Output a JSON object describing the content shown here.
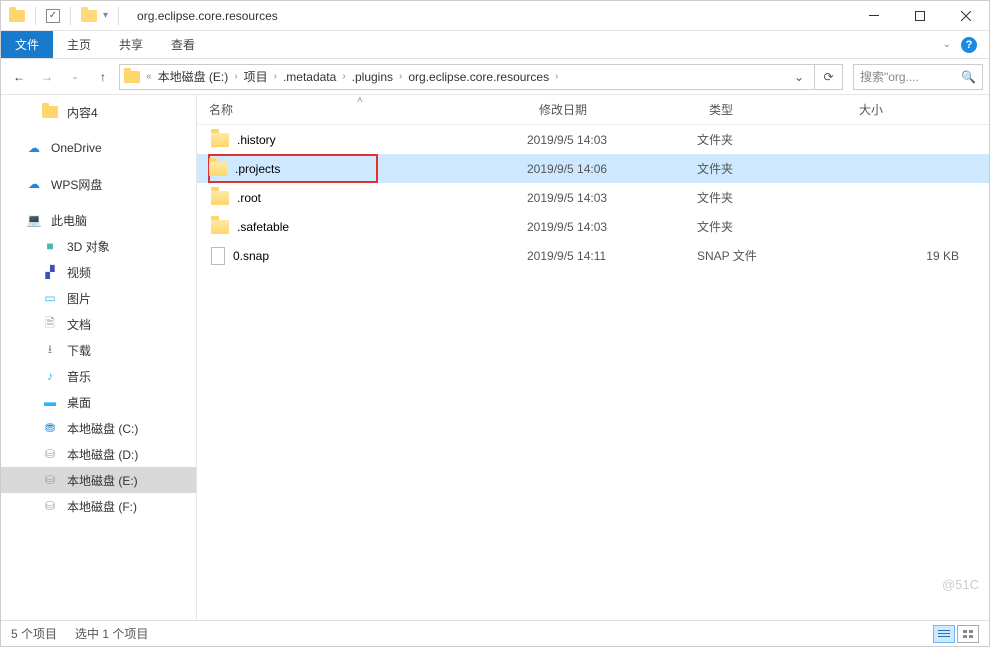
{
  "titlebar": {
    "title": "org.eclipse.core.resources"
  },
  "ribbon": {
    "tabs": [
      "文件",
      "主页",
      "共享",
      "查看"
    ],
    "active_index": 0
  },
  "breadcrumb": {
    "items": [
      "本地磁盘 (E:)",
      "项目",
      ".metadata",
      ".plugins",
      "org.eclipse.core.resources"
    ]
  },
  "search": {
    "placeholder": "搜索\"org...."
  },
  "columns": {
    "name": "名称",
    "date": "修改日期",
    "type": "类型",
    "size": "大小"
  },
  "sidebar": {
    "items": [
      {
        "label": "内容4",
        "icon": "folder",
        "indent": true
      },
      {
        "label": "OneDrive",
        "icon": "cloud"
      },
      {
        "label": "WPS网盘",
        "icon": "cloud-outline"
      },
      {
        "label": "此电脑",
        "icon": "pc"
      },
      {
        "label": "3D 对象",
        "icon": "3d",
        "indent": true
      },
      {
        "label": "视频",
        "icon": "video",
        "indent": true
      },
      {
        "label": "图片",
        "icon": "pic",
        "indent": true
      },
      {
        "label": "文档",
        "icon": "doc",
        "indent": true
      },
      {
        "label": "下载",
        "icon": "download",
        "indent": true
      },
      {
        "label": "音乐",
        "icon": "music",
        "indent": true
      },
      {
        "label": "桌面",
        "icon": "desktop",
        "indent": true
      },
      {
        "label": "本地磁盘 (C:)",
        "icon": "drive-c",
        "indent": true
      },
      {
        "label": "本地磁盘 (D:)",
        "icon": "drive",
        "indent": true
      },
      {
        "label": "本地磁盘 (E:)",
        "icon": "drive",
        "indent": true,
        "selected": true
      },
      {
        "label": "本地磁盘 (F:)",
        "icon": "drive",
        "indent": true
      }
    ]
  },
  "files": [
    {
      "name": ".history",
      "date": "2019/9/5 14:03",
      "type": "文件夹",
      "size": "",
      "kind": "folder"
    },
    {
      "name": ".projects",
      "date": "2019/9/5 14:06",
      "type": "文件夹",
      "size": "",
      "kind": "folder",
      "selected": true,
      "highlighted": true
    },
    {
      "name": ".root",
      "date": "2019/9/5 14:03",
      "type": "文件夹",
      "size": "",
      "kind": "folder"
    },
    {
      "name": ".safetable",
      "date": "2019/9/5 14:03",
      "type": "文件夹",
      "size": "",
      "kind": "folder"
    },
    {
      "name": "0.snap",
      "date": "2019/9/5 14:11",
      "type": "SNAP 文件",
      "size": "19 KB",
      "kind": "file"
    }
  ],
  "statusbar": {
    "count": "5 个项目",
    "selection": "选中 1 个项目"
  },
  "watermark": "@51C"
}
